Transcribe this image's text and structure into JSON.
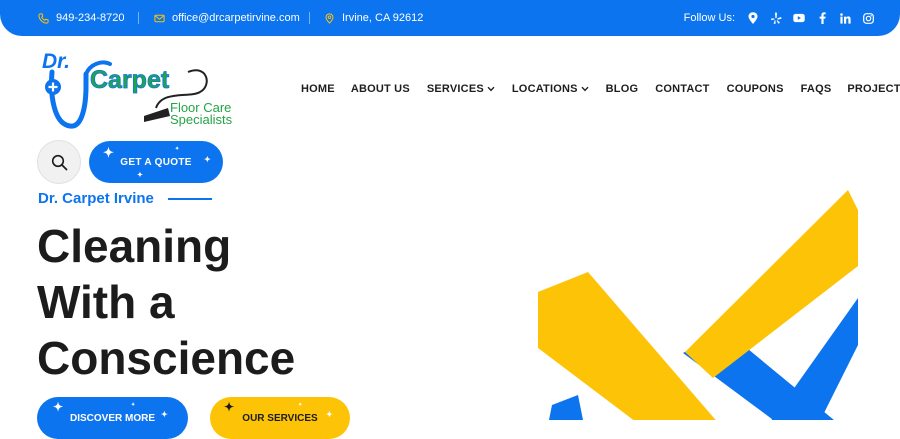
{
  "topbar": {
    "phone": "949-234-8720",
    "email": "office@drcarpetirvine.com",
    "address": "Irvine, CA 92612",
    "follow_label": "Follow Us:",
    "social_icons": [
      "location-pin-icon",
      "yelp-icon",
      "youtube-icon",
      "facebook-icon",
      "linkedin-icon",
      "instagram-icon"
    ]
  },
  "logo": {
    "dr": "Dr.",
    "carpet": "Carpet",
    "tagline_1": "Floor Care",
    "tagline_2": "Specialists"
  },
  "nav": {
    "items": [
      {
        "label": "HOME",
        "dropdown": false
      },
      {
        "label": "ABOUT US",
        "dropdown": false
      },
      {
        "label": "SERVICES",
        "dropdown": true
      },
      {
        "label": "LOCATIONS",
        "dropdown": true
      },
      {
        "label": "BLOG",
        "dropdown": false
      },
      {
        "label": "CONTACT",
        "dropdown": false
      },
      {
        "label": "COUPONS",
        "dropdown": false
      },
      {
        "label": "FAQS",
        "dropdown": false
      },
      {
        "label": "PROJECTS",
        "dropdown": false
      }
    ]
  },
  "actions": {
    "quote_label": "GET A QUOTE"
  },
  "hero": {
    "eyebrow": "Dr. Carpet Irvine",
    "headline_lines": [
      "Cleaning",
      "With a",
      "Conscience"
    ],
    "discover_label": "DISCOVER MORE",
    "services_label": "OUR SERVICES"
  },
  "colors": {
    "primary_blue": "#0d74ef",
    "accent_yellow": "#fdc307",
    "logo_green": "#23a447",
    "text_dark": "#1c1c1c"
  }
}
